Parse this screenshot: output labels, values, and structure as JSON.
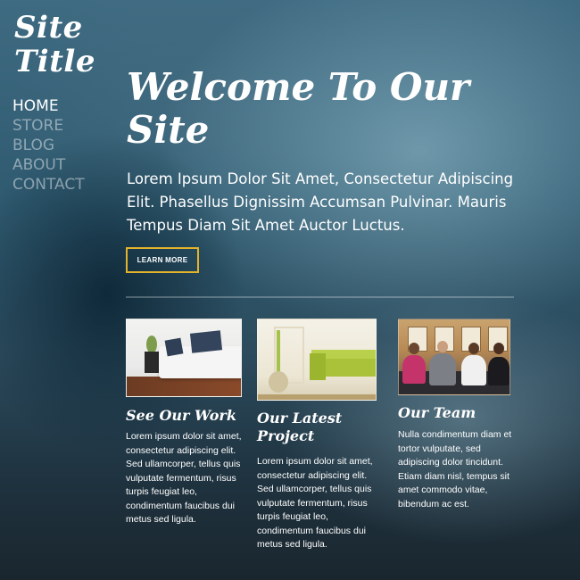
{
  "site": {
    "logo_line1": "Site",
    "logo_line2": "Title"
  },
  "nav": {
    "items": [
      {
        "label": "HOME",
        "active": true
      },
      {
        "label": "STORE",
        "active": false
      },
      {
        "label": "BLOG",
        "active": false
      },
      {
        "label": "ABOUT",
        "active": false
      },
      {
        "label": "CONTACT",
        "active": false
      }
    ]
  },
  "hero": {
    "headline_line1": "Welcome To Our",
    "headline_line2": "Site",
    "intro": "Lorem Ipsum Dolor Sit Amet, Consectetur Adipiscing Elit. Phasellus Dignissim Accumsan Pulvinar. Mauris Tempus Diam Sit Amet Auctor Luctus.",
    "cta_label": "LEARN MORE",
    "cta_border_color": "#e3b32b"
  },
  "cards": [
    {
      "title": "See Our Work",
      "body": "Lorem ipsum dolor sit amet, consectetur adipiscing elit. Sed ullamcorper, tellus quis vulputate fermentum, risus turpis feugiat leo, condimentum faucibus dui metus sed ligula."
    },
    {
      "title_line1": "Our Latest",
      "title_line2": "Project",
      "body": "Lorem ipsum dolor sit amet, consectetur adipiscing elit. Sed ullamcorper, tellus quis vulputate fermentum, risus turpis feugiat leo, condimentum faucibus dui metus sed ligula."
    },
    {
      "title": "Our Team",
      "body": "Nulla condimentum diam et tortor vulputate, sed adipiscing dolor tincidunt. Etiam diam nisl, tempus sit amet commodo vitae, bibendum ac est."
    }
  ]
}
